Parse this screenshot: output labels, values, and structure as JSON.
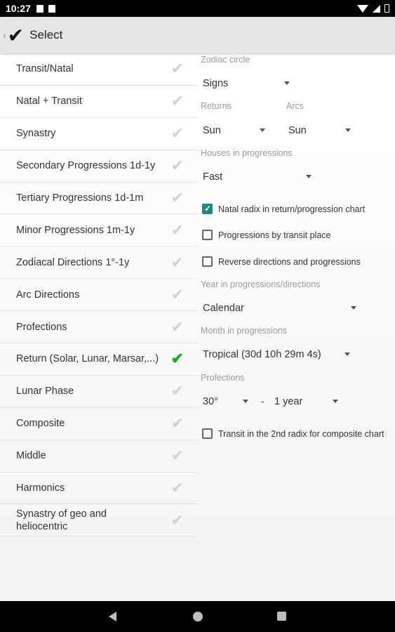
{
  "status_bar": {
    "time": "10:27"
  },
  "toolbar": {
    "back_glyph": "‹",
    "check_glyph": "✔",
    "title": "Select"
  },
  "chart_types": [
    {
      "label": "Transit/Natal",
      "selected": false
    },
    {
      "label": "Natal + Transit",
      "selected": false
    },
    {
      "label": "Synastry",
      "selected": false
    },
    {
      "label": "Secondary Progressions 1d-1y",
      "selected": false
    },
    {
      "label": "Tertiary Progressions 1d-1m",
      "selected": false
    },
    {
      "label": "Minor Progressions 1m-1y",
      "selected": false
    },
    {
      "label": "Zodiacal Directions 1°-1y",
      "selected": false
    },
    {
      "label": "Arc Directions",
      "selected": false
    },
    {
      "label": "Profections",
      "selected": false
    },
    {
      "label": "Return (Solar, Lunar, Marsar,...)",
      "selected": true
    },
    {
      "label": "Lunar Phase",
      "selected": false
    },
    {
      "label": "Composite",
      "selected": false
    },
    {
      "label": "Middle",
      "selected": false
    },
    {
      "label": "Harmonics",
      "selected": false
    },
    {
      "label": "Synastry of geo and heliocentric",
      "selected": false
    }
  ],
  "tick_glyph": "✔",
  "settings": {
    "zodiac_label": "Zodiac circle",
    "zodiac_value": "Signs",
    "returns_label": "Returns",
    "returns_value": "Sun",
    "arcs_label": "Arcs",
    "arcs_value": "Sun",
    "houses_label": "Houses in progressions",
    "houses_value": "Fast",
    "cb_natal_radix": {
      "label": "Natal radix in return/progression chart",
      "checked": true
    },
    "cb_progressions_transit": {
      "label": "Progressions by transit place",
      "checked": false
    },
    "cb_reverse": {
      "label": "Reverse directions and progressions",
      "checked": false
    },
    "year_label": "Year in progressions/directions",
    "year_value": "Calendar",
    "month_label": "Month in progressions",
    "month_value": "Tropical (30d 10h 29m 4s)",
    "profections_label": "Profections",
    "profections_from": "30°",
    "profections_dash": "-",
    "profections_to": "1 year",
    "cb_transit_2nd": {
      "label": "Transit in the 2nd radix for composite chart",
      "checked": false
    }
  },
  "colors": {
    "accent_check": "#1faa1f",
    "checkbox_on": "#1b8a7e",
    "toolbar_bg": "#e6e6e6"
  }
}
